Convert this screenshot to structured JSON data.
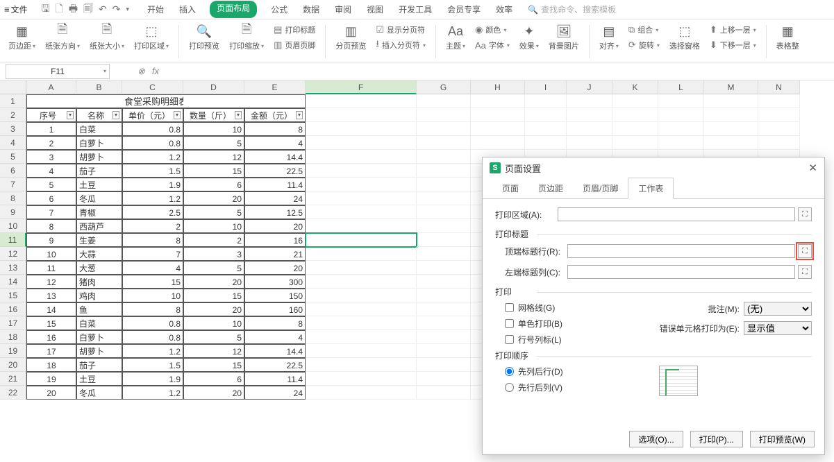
{
  "menu": {
    "file": "文件",
    "tabs": [
      "开始",
      "插入",
      "页面布局",
      "公式",
      "数据",
      "审阅",
      "视图",
      "开发工具",
      "会员专享",
      "效率"
    ],
    "active_tab": "页面布局",
    "search_placeholder": "查找命令、搜索模板"
  },
  "ribbon": {
    "margins": "页边距",
    "orientation": "纸张方向",
    "size": "纸张大小",
    "print_area": "打印区域",
    "print_preview": "打印预览",
    "print_scale": "打印缩放",
    "print_titles": "打印标题",
    "header_footer": "页眉页脚",
    "page_break_preview": "分页预览",
    "show_page_break": "显示分页符",
    "insert_page_break": "插入分页符",
    "theme": "主题",
    "color": "颜色",
    "font": "字体",
    "effect": "效果",
    "bg_image": "背景图片",
    "align": "对齐",
    "rotate": "旋转",
    "group": "组合",
    "select_pane": "选择窗格",
    "bring_fwd": "上移一层",
    "send_back": "下移一层",
    "table_tools": "表格整"
  },
  "formula_bar": {
    "name_box": "F11",
    "fx": "fx"
  },
  "columns": [
    "A",
    "B",
    "C",
    "D",
    "E",
    "F",
    "G",
    "H",
    "I",
    "J",
    "K",
    "L",
    "M",
    "N"
  ],
  "selected_col": "F",
  "selected_row": 11,
  "title_row": "食堂采购明细表",
  "headers": [
    "序号",
    "名称",
    "单价（元）",
    "数量（斤）",
    "金额（元）"
  ],
  "rows": [
    {
      "n": "1",
      "name": "白菜",
      "price": "0.8",
      "qty": "10",
      "amt": "8"
    },
    {
      "n": "2",
      "name": "白萝卜",
      "price": "0.8",
      "qty": "5",
      "amt": "4"
    },
    {
      "n": "3",
      "name": "胡萝卜",
      "price": "1.2",
      "qty": "12",
      "amt": "14.4"
    },
    {
      "n": "4",
      "name": "茄子",
      "price": "1.5",
      "qty": "15",
      "amt": "22.5"
    },
    {
      "n": "5",
      "name": "土豆",
      "price": "1.9",
      "qty": "6",
      "amt": "11.4"
    },
    {
      "n": "6",
      "name": "冬瓜",
      "price": "1.2",
      "qty": "20",
      "amt": "24"
    },
    {
      "n": "7",
      "name": "青椒",
      "price": "2.5",
      "qty": "5",
      "amt": "12.5"
    },
    {
      "n": "8",
      "name": "西葫芦",
      "price": "2",
      "qty": "10",
      "amt": "20"
    },
    {
      "n": "9",
      "name": "生姜",
      "price": "8",
      "qty": "2",
      "amt": "16"
    },
    {
      "n": "10",
      "name": "大蒜",
      "price": "7",
      "qty": "3",
      "amt": "21"
    },
    {
      "n": "11",
      "name": "大葱",
      "price": "4",
      "qty": "5",
      "amt": "20"
    },
    {
      "n": "12",
      "name": "猪肉",
      "price": "15",
      "qty": "20",
      "amt": "300"
    },
    {
      "n": "13",
      "name": "鸡肉",
      "price": "10",
      "qty": "15",
      "amt": "150"
    },
    {
      "n": "14",
      "name": "鱼",
      "price": "8",
      "qty": "20",
      "amt": "160"
    },
    {
      "n": "15",
      "name": "白菜",
      "price": "0.8",
      "qty": "10",
      "amt": "8"
    },
    {
      "n": "16",
      "name": "白萝卜",
      "price": "0.8",
      "qty": "5",
      "amt": "4"
    },
    {
      "n": "17",
      "name": "胡萝卜",
      "price": "1.2",
      "qty": "12",
      "amt": "14.4"
    },
    {
      "n": "18",
      "name": "茄子",
      "price": "1.5",
      "qty": "15",
      "amt": "22.5"
    },
    {
      "n": "19",
      "name": "土豆",
      "price": "1.9",
      "qty": "6",
      "amt": "11.4"
    },
    {
      "n": "20",
      "name": "冬瓜",
      "price": "1.2",
      "qty": "20",
      "amt": "24"
    }
  ],
  "dialog": {
    "title": "页面设置",
    "tabs": [
      "页面",
      "页边距",
      "页眉/页脚",
      "工作表"
    ],
    "active_tab": "工作表",
    "print_area_label": "打印区域(A):",
    "print_titles_label": "打印标题",
    "top_title_rows": "顶端标题行(R):",
    "left_title_cols": "左端标题列(C):",
    "print_label": "打印",
    "gridlines": "网格线(G)",
    "mono": "单色打印(B)",
    "row_col_headings": "行号列标(L)",
    "comments_label": "批注(M):",
    "comments_value": "(无)",
    "errors_label": "错误单元格打印为(E):",
    "errors_value": "显示值",
    "order_label": "打印顺序",
    "down_then_over": "先列后行(D)",
    "over_then_down": "先行后列(V)",
    "btn_options": "选项(O)...",
    "btn_print": "打印(P)...",
    "btn_preview": "打印预览(W)"
  }
}
